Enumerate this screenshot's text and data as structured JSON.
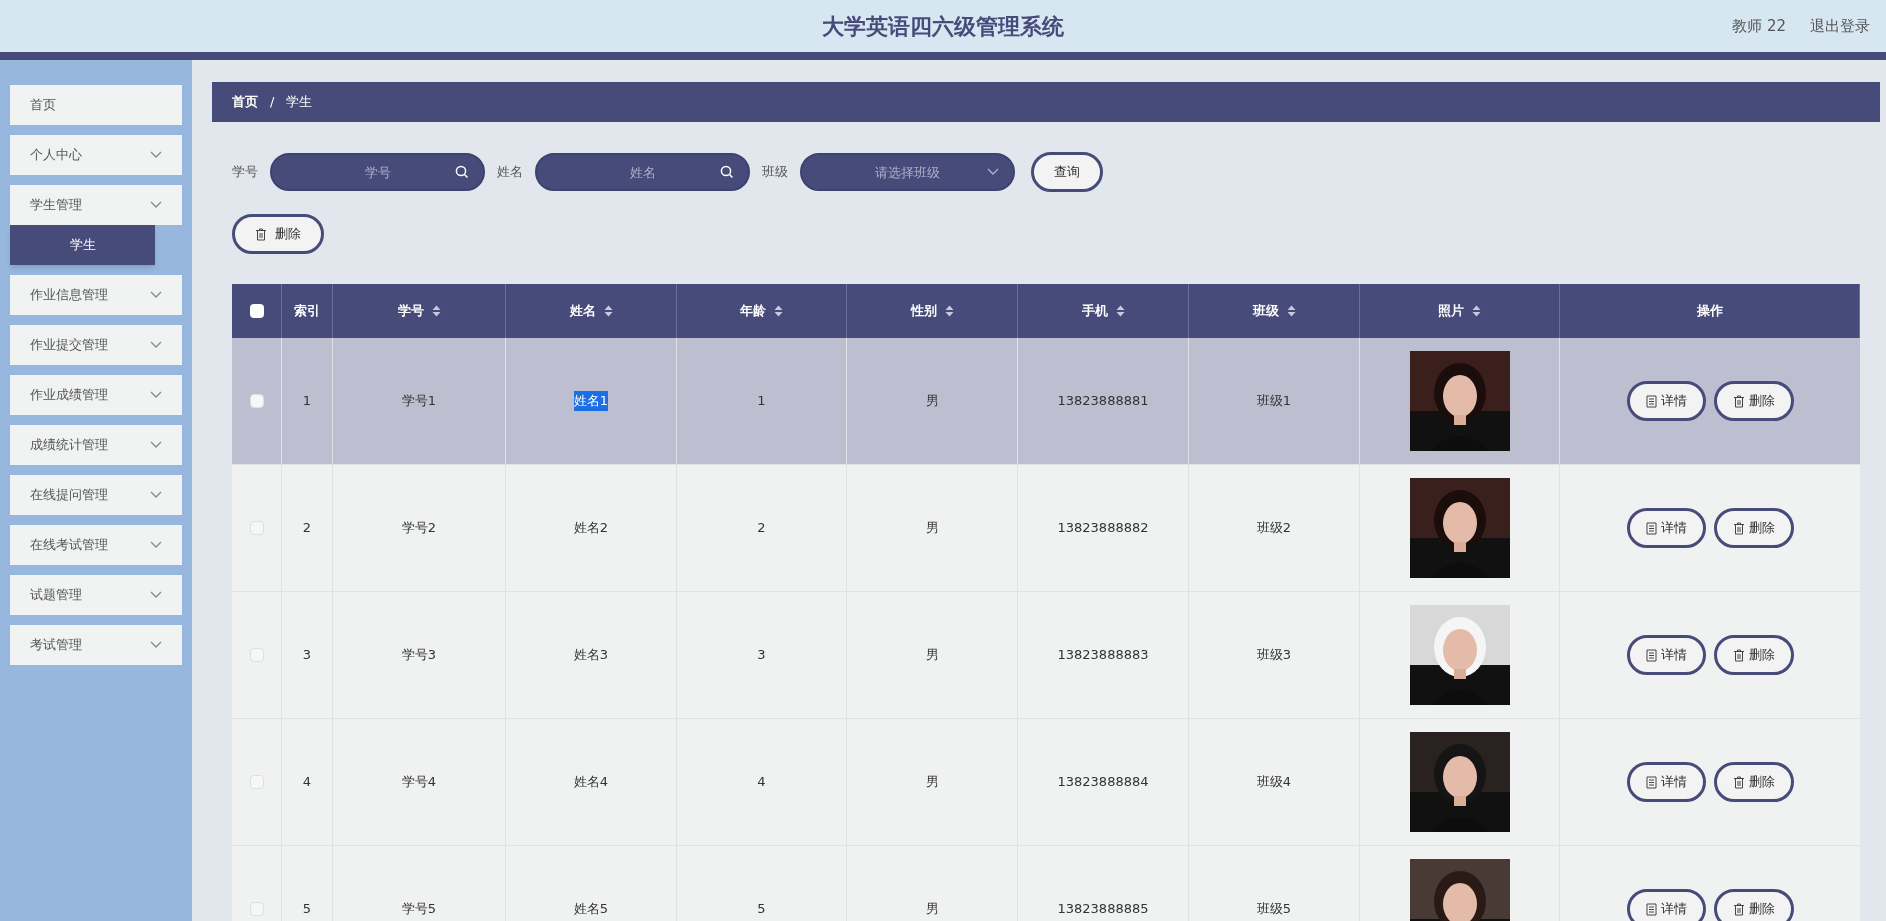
{
  "header": {
    "title": "大学英语四六级管理系统",
    "user": "教师 22",
    "logout": "退出登录"
  },
  "sidebar": {
    "items": [
      {
        "label": "首页",
        "has_arrow": false
      },
      {
        "label": "个人中心",
        "has_arrow": true
      },
      {
        "label": "学生管理",
        "has_arrow": true,
        "children": [
          {
            "label": "学生",
            "selected": true
          }
        ]
      },
      {
        "label": "作业信息管理",
        "has_arrow": true
      },
      {
        "label": "作业提交管理",
        "has_arrow": true
      },
      {
        "label": "作业成绩管理",
        "has_arrow": true
      },
      {
        "label": "成绩统计管理",
        "has_arrow": true
      },
      {
        "label": "在线提问管理",
        "has_arrow": true
      },
      {
        "label": "在线考试管理",
        "has_arrow": true
      },
      {
        "label": "试题管理",
        "has_arrow": true
      },
      {
        "label": "考试管理",
        "has_arrow": true
      }
    ]
  },
  "breadcrumb": [
    "首页",
    "/",
    "学生"
  ],
  "search": {
    "fields": [
      {
        "kind": "text",
        "label": "学号",
        "placeholder": "学号"
      },
      {
        "kind": "text",
        "label": "姓名",
        "placeholder": "姓名"
      },
      {
        "kind": "select",
        "label": "班级",
        "placeholder": "请选择班级"
      }
    ],
    "button": "查询"
  },
  "delete_button": "删除",
  "table": {
    "columns": [
      {
        "kind": "checkbox",
        "checked": false
      },
      {
        "kind": "text",
        "label": "索引",
        "sortable": false
      },
      {
        "kind": "text",
        "label": "学号",
        "sortable": true
      },
      {
        "kind": "text",
        "label": "姓名",
        "sortable": true
      },
      {
        "kind": "text",
        "label": "年龄",
        "sortable": true
      },
      {
        "kind": "text",
        "label": "性别",
        "sortable": true
      },
      {
        "kind": "text",
        "label": "手机",
        "sortable": true
      },
      {
        "kind": "text",
        "label": "班级",
        "sortable": true
      },
      {
        "kind": "text",
        "label": "照片",
        "sortable": true
      },
      {
        "kind": "text",
        "label": "操作",
        "sortable": false
      }
    ],
    "rows": [
      {
        "selected": true,
        "checked": false,
        "index": "1",
        "id": "学号1",
        "name": "姓名1",
        "name_highlighted": true,
        "age": "1",
        "gender": "男",
        "phone": "13823888881",
        "class": "班级1",
        "photo": {
          "kind": "picture"
        },
        "actions": [
          "详情",
          "删除"
        ]
      },
      {
        "selected": false,
        "checked": false,
        "index": "2",
        "id": "学号2",
        "name": "姓名2",
        "name_highlighted": false,
        "age": "2",
        "gender": "男",
        "phone": "13823888882",
        "class": "班级2",
        "photo": {
          "kind": "picture"
        },
        "actions": [
          "详情",
          "删除"
        ]
      },
      {
        "selected": false,
        "checked": false,
        "index": "3",
        "id": "学号3",
        "name": "姓名3",
        "name_highlighted": false,
        "age": "3",
        "gender": "男",
        "phone": "13823888883",
        "class": "班级3",
        "photo": {
          "kind": "picture"
        },
        "actions": [
          "详情",
          "删除"
        ]
      },
      {
        "selected": false,
        "checked": false,
        "index": "4",
        "id": "学号4",
        "name": "姓名4",
        "name_highlighted": false,
        "age": "4",
        "gender": "男",
        "phone": "13823888884",
        "class": "班级4",
        "photo": {
          "kind": "picture"
        },
        "actions": [
          "详情",
          "删除"
        ]
      },
      {
        "selected": false,
        "checked": false,
        "index": "5",
        "id": "学号5",
        "name": "姓名5",
        "name_highlighted": false,
        "age": "5",
        "gender": "男",
        "phone": "13823888885",
        "class": "班级5",
        "photo": {
          "kind": "picture"
        },
        "actions": [
          "详情",
          "删除"
        ]
      }
    ]
  }
}
